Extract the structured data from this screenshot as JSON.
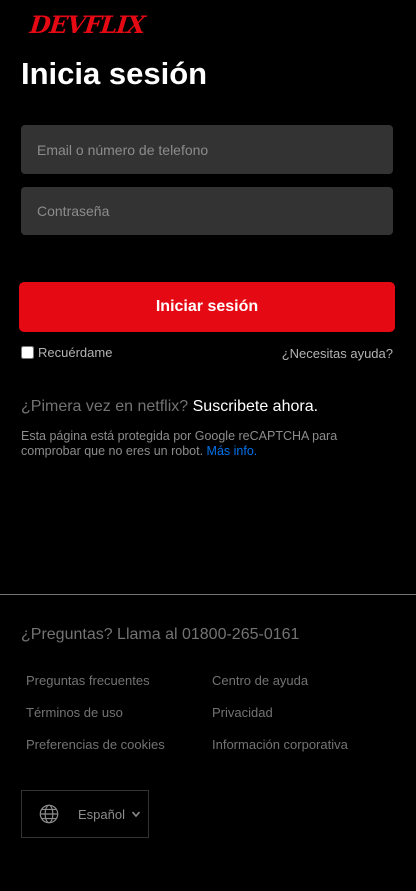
{
  "header": {
    "logo_text": "DEVFLIX",
    "title": "Inicia sesión"
  },
  "form": {
    "email_placeholder": "Email o número de telefono",
    "password_placeholder": "Contraseña",
    "submit_label": "Iniciar sesión",
    "remember_label": "Recuérdame",
    "help_link": "¿Necesitas ayuda?"
  },
  "signup": {
    "prompt": "¿Pimera vez en netflix? ",
    "link": "Suscribete ahora",
    "suffix": "."
  },
  "captcha": {
    "text": "Esta página está protegida por Google reCAPTCHA para comprobar que no eres un robot. ",
    "link": "Más info."
  },
  "footer": {
    "questions": "¿Preguntas? Llama al 01800-265-0161",
    "links": [
      "Preguntas frecuentes",
      "Centro de ayuda",
      "Términos de uso",
      "Privacidad",
      "Preferencias de cookies",
      "Información corporativa"
    ],
    "language": {
      "selected": "Español",
      "icon": "globe-icon"
    }
  },
  "colors": {
    "background": "#000000",
    "brand_red": "#e50914",
    "input_bg": "#333333",
    "muted_text": "#737373",
    "link_blue": "#0071eb"
  }
}
